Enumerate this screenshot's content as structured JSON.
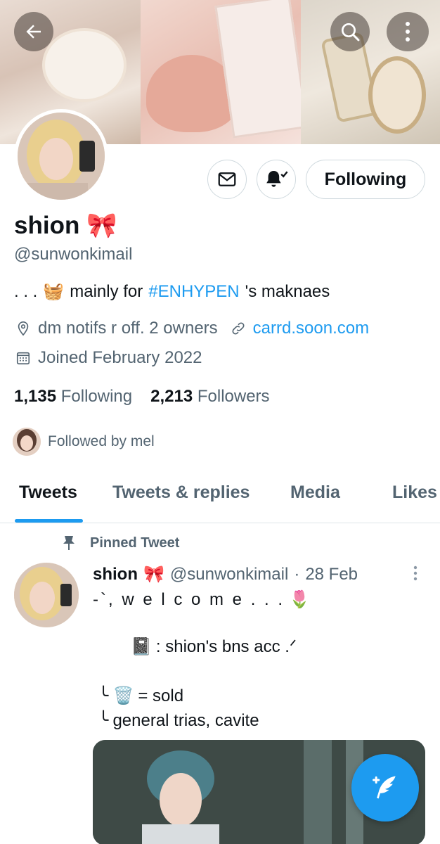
{
  "header": {
    "back_icon": "back-arrow-icon",
    "search_icon": "search-icon",
    "more_icon": "more-vertical-icon"
  },
  "profile": {
    "name": "shion",
    "name_emoji": "🎀",
    "handle": "@sunwonkimail",
    "bio_prefix": ". . .",
    "bio_emoji": "🧺",
    "bio_text_1": "mainly for",
    "bio_hashtag": "#ENHYPEN",
    "bio_text_2": "'s maknaes",
    "location": "dm notifs r off. 2 owners",
    "website": "carrd.soon.com",
    "joined": "Joined February 2022",
    "following_count": "1,135",
    "following_label": "Following",
    "followers_count": "2,213",
    "followers_label": "Followers",
    "followed_by": "Followed by mel"
  },
  "actions": {
    "following_button": "Following"
  },
  "tabs": [
    {
      "label": "Tweets",
      "active": true
    },
    {
      "label": "Tweets & replies",
      "active": false
    },
    {
      "label": "Media",
      "active": false
    },
    {
      "label": "Likes",
      "active": false
    }
  ],
  "pinned_tweet": {
    "pinned_label": "Pinned Tweet",
    "author_name": "shion",
    "author_emoji": "🎀",
    "author_handle": "@sunwonkimail",
    "separator": "·",
    "date": "28 Feb",
    "line1": "-`, w e l c o m e . . .",
    "line1_emoji": "🌷",
    "line2_emoji": "📓",
    "line2": ": shion's bns acc .ᐟ",
    "line3_prefix": "╰",
    "line3_emoji": "🗑️",
    "line3": "= sold",
    "line4_prefix": "╰",
    "line4": "general trias, cavite"
  },
  "colors": {
    "accent": "#1d9bf0",
    "text_primary": "#0f1419",
    "text_secondary": "#536471",
    "border": "#cfd9de"
  }
}
